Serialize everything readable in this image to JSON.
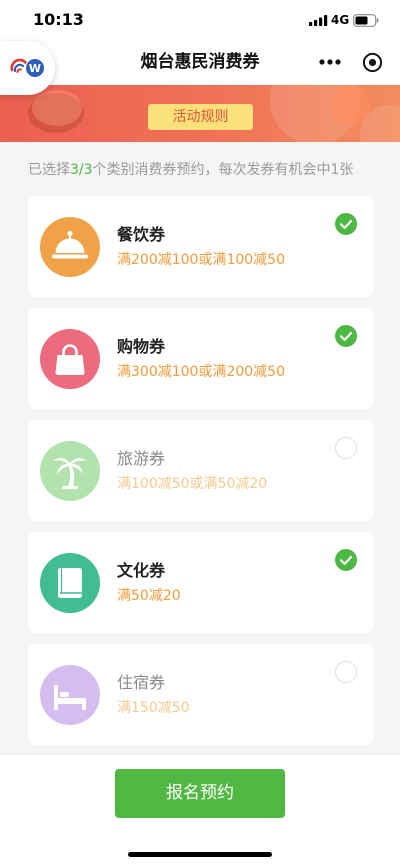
{
  "status_bar": {
    "time": "10:13",
    "network": "4G",
    "signal_icon": "signal-icon",
    "battery_icon": "battery-icon"
  },
  "capsule": {
    "logo_icon": "app-logo-icon",
    "badge_text": "W"
  },
  "nav": {
    "title": "烟台惠民消费券",
    "more_icon": "more-dots-icon",
    "target_icon": "target-icon"
  },
  "banner": {
    "rules_button": "活动规则"
  },
  "summary": {
    "prefix": "已选择",
    "count": "3/3",
    "suffix": "个类别消费券预约，每次发券有机会中1张"
  },
  "vouchers": [
    {
      "name": "餐饮券",
      "desc": "满200减100或满100减50",
      "icon": "cloche-icon",
      "icon_color": "#f0a248",
      "selected": true
    },
    {
      "name": "购物券",
      "desc": "满300减100或满200减50",
      "icon": "shopping-bag-icon",
      "icon_color": "#ec6b7e",
      "selected": true
    },
    {
      "name": "旅游券",
      "desc": "满100减50或满50减20",
      "icon": "palm-tree-icon",
      "icon_color": "#b2e2ad",
      "selected": false
    },
    {
      "name": "文化券",
      "desc": "满50减20",
      "icon": "book-icon",
      "icon_color": "#42bc92",
      "selected": true
    },
    {
      "name": "住宿券",
      "desc": "满150减50",
      "icon": "bed-icon",
      "icon_color": "#d6bdf0",
      "selected": false
    }
  ],
  "footer": {
    "submit_button": "报名预约"
  },
  "colors": {
    "accent": "#4cb944",
    "desc": "#f29c3b",
    "desc_muted": "#f6c98f",
    "banner_start": "#ec5f50",
    "banner_end": "#f28d5f",
    "rules_bg": "#fce07a",
    "button": "#50b843"
  }
}
